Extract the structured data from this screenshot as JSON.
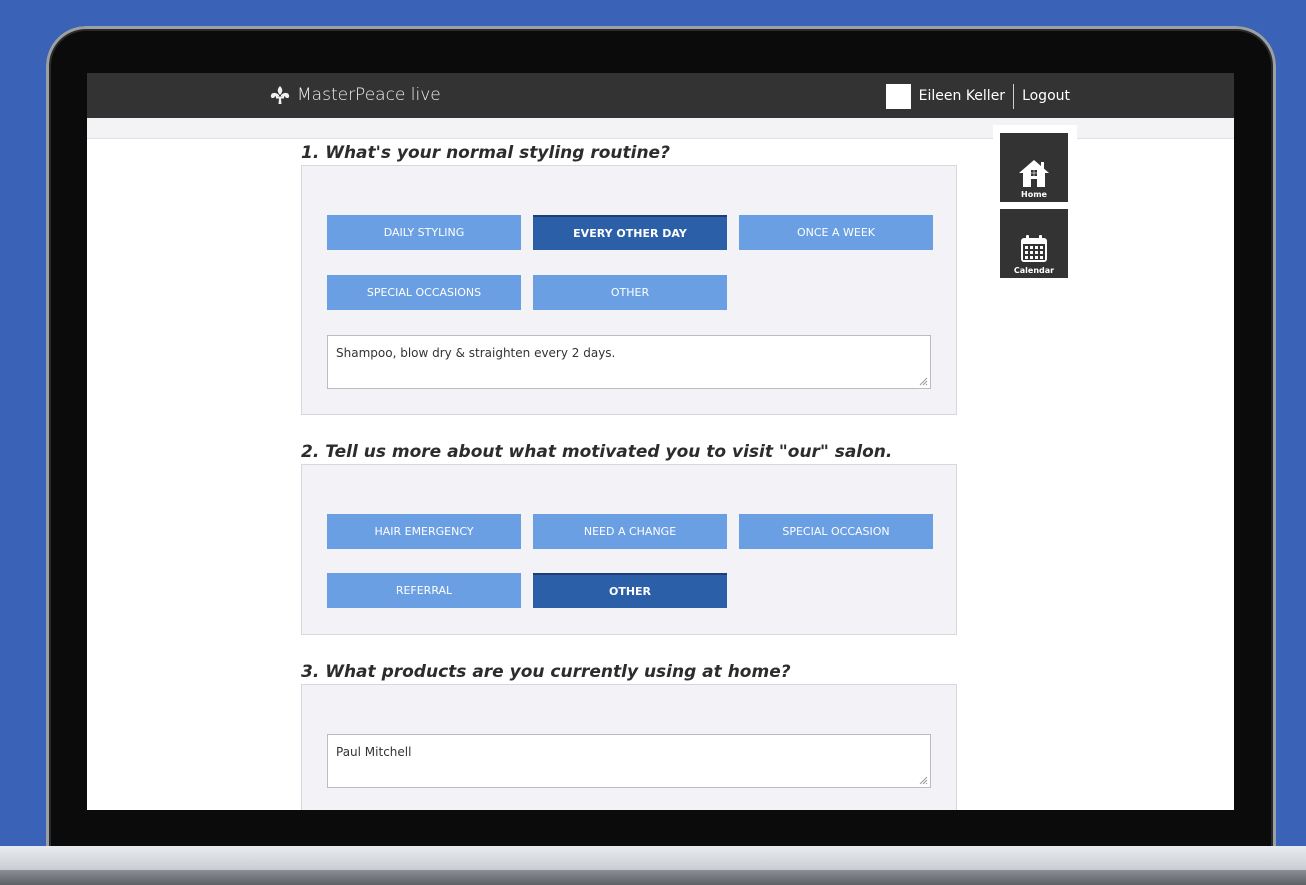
{
  "header": {
    "brand": "MasterPeace live",
    "user_name": "Eileen Keller",
    "logout_label": "Logout"
  },
  "sidenav": {
    "items": [
      {
        "label": "Home",
        "icon": "home-icon"
      },
      {
        "label": "Calendar",
        "icon": "calendar-icon"
      }
    ]
  },
  "questions": [
    {
      "title": "1. What's your normal styling routine?",
      "options": [
        "DAILY STYLING",
        "EVERY OTHER DAY",
        "ONCE A WEEK",
        "SPECIAL OCCASIONS",
        "OTHER"
      ],
      "selected": "EVERY OTHER DAY",
      "textarea_value": "Shampoo, blow dry & straighten every 2 days."
    },
    {
      "title": "2. Tell us more about what motivated you to visit \"our\" salon.",
      "options": [
        "HAIR EMERGENCY",
        "NEED A CHANGE",
        "SPECIAL OCCASION",
        "REFERRAL",
        "OTHER"
      ],
      "selected": "OTHER"
    },
    {
      "title": "3. What products are you currently using at home?",
      "textarea_value": "Paul Mitchell"
    }
  ],
  "colors": {
    "background": "#3a63b8",
    "topbar": "#333333",
    "option": "#6a9fe3",
    "option_selected": "#2b60a8",
    "panel": "#f3f3f7"
  }
}
